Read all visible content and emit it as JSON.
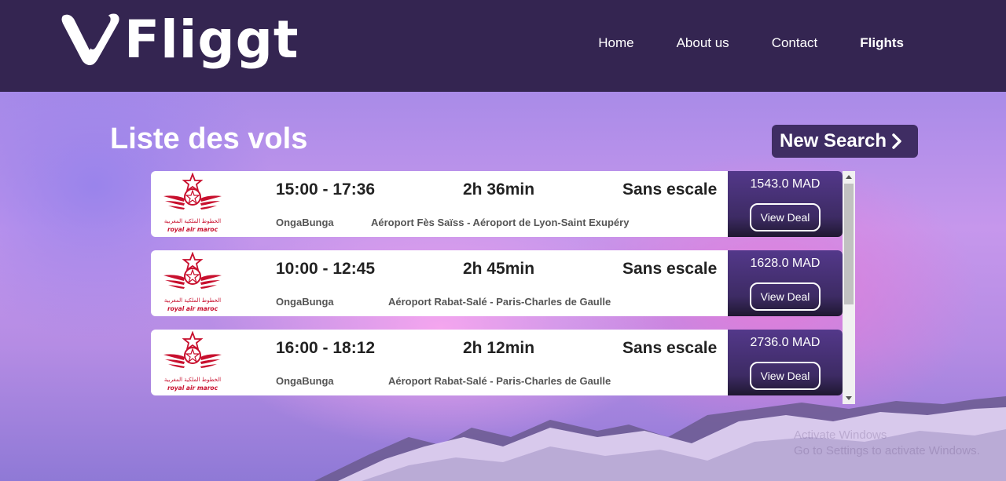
{
  "brand": {
    "name": "Fliggt"
  },
  "nav": [
    {
      "label": "Home",
      "active": false
    },
    {
      "label": "About us",
      "active": false
    },
    {
      "label": "Contact",
      "active": false
    },
    {
      "label": "Flights",
      "active": true
    }
  ],
  "page": {
    "title": "Liste des vols",
    "new_search_label": "New Search"
  },
  "airline_logo": {
    "arabic_text": "الخطوط الملكية المغربية",
    "latin_text": "royal air maroc"
  },
  "flights": [
    {
      "time": "15:00 - 17:36",
      "duration": "2h 36min",
      "stops": "Sans escale",
      "agency": "OngaBunga",
      "route": "Aéroport Fès Saïss - Aéroport de Lyon-Saint Exupéry",
      "price": "1543.0 MAD",
      "button": "View Deal"
    },
    {
      "time": "10:00 - 12:45",
      "duration": "2h 45min",
      "stops": "Sans escale",
      "agency": "OngaBunga",
      "route": "Aéroport Rabat-Salé - Paris-Charles de Gaulle",
      "price": "1628.0 MAD",
      "button": "View Deal"
    },
    {
      "time": "16:00 - 18:12",
      "duration": "2h 12min",
      "stops": "Sans escale",
      "agency": "OngaBunga",
      "route": "Aéroport Rabat-Salé - Paris-Charles de Gaulle",
      "price": "2736.0 MAD",
      "button": "View Deal"
    }
  ],
  "watermark": {
    "line1": "Activate Windows",
    "line2": "Go to Settings to activate Windows."
  },
  "colors": {
    "header": "#342551",
    "deal_panel": "#53388a",
    "new_search": "#3f2d63",
    "airline_red": "#c8102e"
  }
}
